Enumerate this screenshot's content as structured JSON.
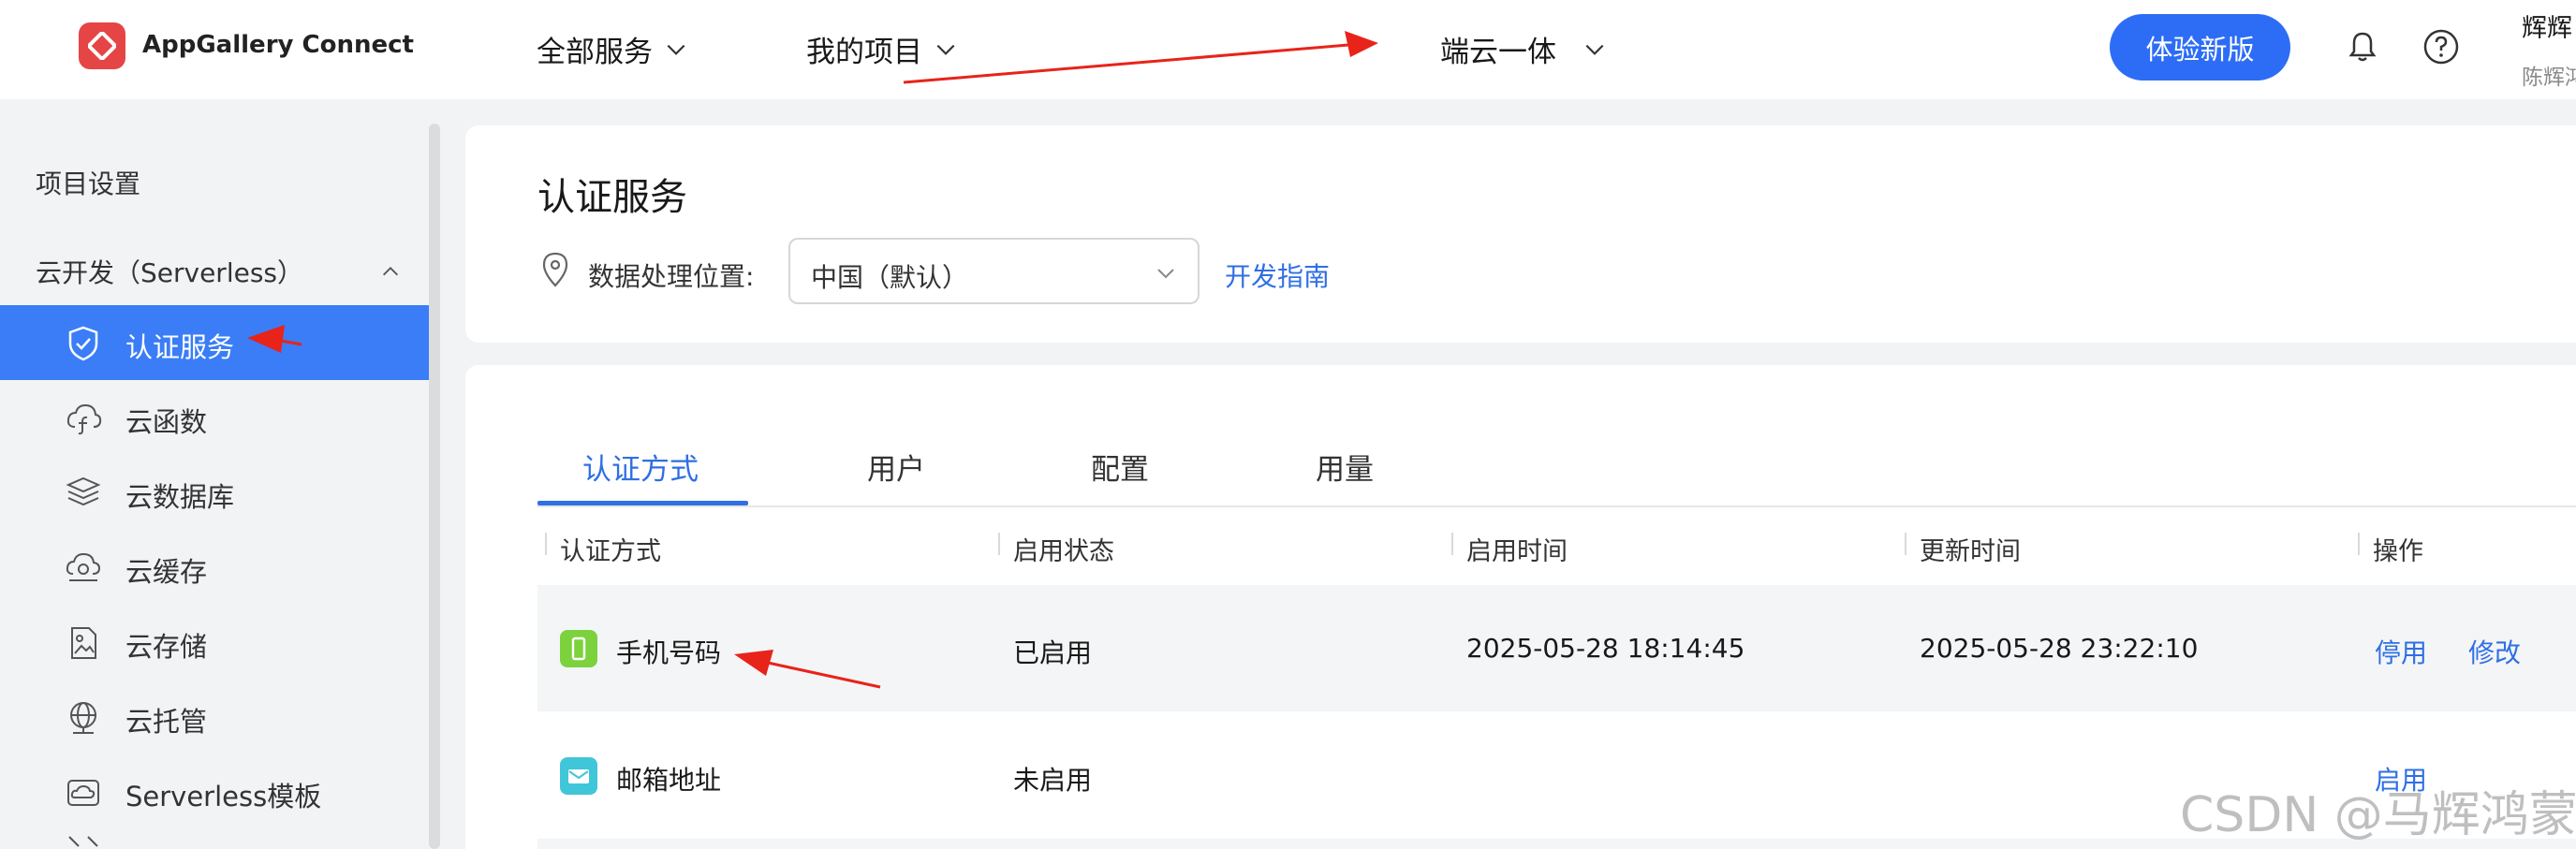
{
  "header": {
    "brand": "AppGallery Connect",
    "nav": [
      "全部服务",
      "我的项目",
      "端云一体"
    ],
    "try_button": "体验新版",
    "user_name": "辉辉",
    "user_sub": "陈辉鸿"
  },
  "sidebar": {
    "project_settings": "项目设置",
    "group_label": "云开发（Serverless）",
    "items": [
      {
        "label": "认证服务",
        "icon": "shield-check-icon",
        "active": true
      },
      {
        "label": "云函数",
        "icon": "cloud-function-icon"
      },
      {
        "label": "云数据库",
        "icon": "database-layers-icon"
      },
      {
        "label": "云缓存",
        "icon": "cloud-cache-icon"
      },
      {
        "label": "云存储",
        "icon": "cloud-storage-icon"
      },
      {
        "label": "云托管",
        "icon": "globe-hosting-icon"
      },
      {
        "label": "Serverless模板",
        "icon": "template-icon"
      }
    ]
  },
  "page": {
    "title": "认证服务",
    "location_label": "数据处理位置:",
    "location_value": "中国（默认）",
    "guide_link": "开发指南"
  },
  "tabs": [
    "认证方式",
    "用户",
    "配置",
    "用量"
  ],
  "table": {
    "headers": [
      "认证方式",
      "启用状态",
      "启用时间",
      "更新时间",
      "操作"
    ],
    "rows": [
      {
        "method": "手机号码",
        "status": "已启用",
        "enabled_time": "2025-05-28 18:14:45",
        "updated_time": "2025-05-28 23:22:10",
        "actions": [
          "停用",
          "修改"
        ]
      },
      {
        "method": "邮箱地址",
        "status": "未启用",
        "enabled_time": "",
        "updated_time": "",
        "actions": [
          "启用"
        ]
      }
    ]
  },
  "watermark": "CSDN @马辉鸿蒙",
  "colors": {
    "accent": "#2f6fe4",
    "active_bg": "#3a7df7",
    "logo": "#e64545",
    "arrow": "#e8231a"
  }
}
